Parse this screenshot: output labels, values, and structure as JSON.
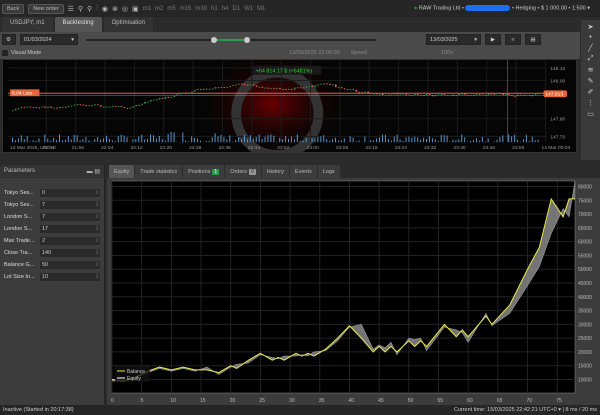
{
  "topbar": {
    "back": "Back",
    "new_order": "New order",
    "timeframes": [
      "m1",
      "m2",
      "m5",
      "m15",
      "m30",
      "h1",
      "h4",
      "D1",
      "W1",
      "M1"
    ],
    "account": {
      "broker": "RAW Trading Ltd",
      "mode": "Hedging",
      "balance": "$ 1 000.00",
      "leverage": "1:500"
    }
  },
  "tabs": [
    {
      "label": "USDJPY, m1"
    },
    {
      "label": "Backtesting"
    },
    {
      "label": "Optimisation"
    }
  ],
  "toolbar": {
    "start_date": "01/03/2024",
    "end_date": "13/03/2025",
    "progress_start": 0.44,
    "progress_end": 0.56
  },
  "visual": {
    "label": "Visual Mode",
    "current": "13/03/2025 23:00:00",
    "speed_label": "Speed:",
    "speed": "100x"
  },
  "pricechart": {
    "pnl": "+64 814.17 $ (+6481%)",
    "line_label": "6.04 Lots",
    "price_tag": "147.913",
    "price_ticks": [
      "148.10",
      "148.00",
      "147.80",
      "147.70"
    ],
    "time_ticks": [
      "13 Mar 2025, UTC+0",
      "21:44",
      "21:56",
      "22:04",
      "22:12",
      "22:20",
      "22:28",
      "22:36",
      "22:44",
      "22:52",
      "23:00",
      "23:08",
      "23:16",
      "23:24",
      "23:32",
      "23:40",
      "23:48",
      "23:56",
      "14 Mar 00:04"
    ],
    "colors": {
      "up": "#2e9a4e",
      "down": "#e8643a",
      "volume": "#5a9ad0",
      "line": "#e8643a"
    }
  },
  "parameters": {
    "title": "Parameters",
    "rows": [
      {
        "label": "Tokyo Ses...",
        "value": "0"
      },
      {
        "label": "Tokyo Ses...",
        "value": "7"
      },
      {
        "label": "London S...",
        "value": "7"
      },
      {
        "label": "London S...",
        "value": "17"
      },
      {
        "label": "Max Trade...",
        "value": "2"
      },
      {
        "label": "Close Tra...",
        "value": "140"
      },
      {
        "label": "Balance G...",
        "value": "50"
      },
      {
        "label": "Lot Size In...",
        "value": "10"
      }
    ]
  },
  "bottom_tabs": [
    {
      "label": "Equity"
    },
    {
      "label": "Trade statistics"
    },
    {
      "label": "Positions",
      "badge": "1"
    },
    {
      "label": "Orders",
      "badge": "0"
    },
    {
      "label": "History"
    },
    {
      "label": "Events"
    },
    {
      "label": "Logs"
    }
  ],
  "chart_data": {
    "type": "line",
    "xlim": [
      0,
      78
    ],
    "ylim": [
      10000,
      80000
    ],
    "grid": true,
    "legend": "bottom-left",
    "x_ticks": [
      0,
      5,
      10,
      15,
      20,
      25,
      30,
      35,
      40,
      45,
      50,
      55,
      60,
      65,
      70,
      75
    ],
    "y_ticks": [
      10000,
      15000,
      20000,
      25000,
      30000,
      35000,
      40000,
      45000,
      50000,
      55000,
      60000,
      65000,
      70000,
      75000,
      80000
    ],
    "x": [
      0,
      2,
      4,
      6,
      8,
      10,
      12,
      14,
      16,
      18,
      20,
      21,
      23,
      25,
      27,
      28,
      29,
      31,
      32,
      33,
      34,
      36,
      38,
      40,
      42,
      44,
      45,
      46,
      47,
      48,
      50,
      51,
      52,
      53,
      56,
      58,
      59,
      60,
      63,
      64,
      67,
      70,
      72,
      74,
      76,
      77,
      78
    ],
    "series": [
      {
        "name": "Balance",
        "color": "#e8e84a",
        "values": [
          10000,
          9500,
          11000,
          13000,
          14500,
          13500,
          14500,
          13500,
          13500,
          12500,
          15000,
          14000,
          17000,
          19500,
          17000,
          18000,
          17000,
          19500,
          18500,
          19500,
          18500,
          21000,
          25000,
          29500,
          25000,
          20000,
          22000,
          20000,
          22000,
          20000,
          24000,
          22000,
          24000,
          22000,
          30000,
          25500,
          28000,
          25500,
          33000,
          30000,
          37000,
          50000,
          58000,
          75500,
          69000,
          75500,
          75500
        ]
      },
      {
        "name": "Equity",
        "color": "#888888",
        "values": [
          9500,
          9200,
          10500,
          12500,
          14000,
          13000,
          14000,
          13000,
          14500,
          11800,
          14500,
          15500,
          16000,
          19000,
          18000,
          17500,
          18500,
          18500,
          19000,
          18500,
          20000,
          20500,
          24000,
          29000,
          30000,
          21000,
          22500,
          21500,
          23500,
          19000,
          25000,
          24500,
          25000,
          20500,
          29000,
          28000,
          27000,
          23500,
          34000,
          29500,
          34000,
          44000,
          51000,
          63000,
          72000,
          69000,
          82000
        ]
      }
    ]
  },
  "status": {
    "left": "Inactive (Started in 20:17:38)",
    "time": "Current time: 15/03/2025 22:42:21 UTC+0",
    "ping": "8 ms / 20 ms"
  }
}
